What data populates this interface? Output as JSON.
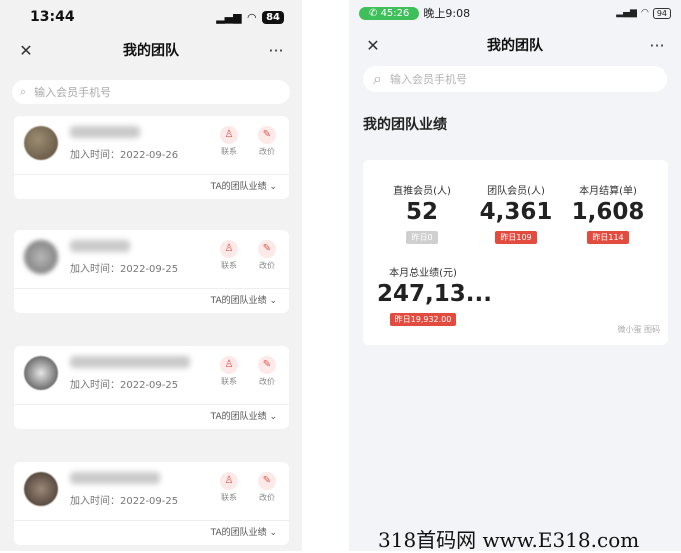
{
  "left": {
    "status": {
      "time": "13:44",
      "battery": "84"
    },
    "nav": {
      "close": "✕",
      "title": "我的团队",
      "more": "···"
    },
    "search": {
      "placeholder": "输入会员手机号"
    },
    "members": [
      {
        "joined": "加入时间：2022-09-26",
        "contact": "联系",
        "edit": "改价",
        "perf": "TA的团队业绩 ⌄"
      },
      {
        "joined": "加入时间：2022-09-25",
        "contact": "联系",
        "edit": "改价",
        "perf": "TA的团队业绩 ⌄"
      },
      {
        "joined": "加入时间：2022-09-25",
        "contact": "联系",
        "edit": "改价",
        "perf": "TA的团队业绩 ⌄"
      },
      {
        "joined": "加入时间：2022-09-25",
        "contact": "联系",
        "edit": "改价",
        "perf": "TA的团队业绩 ⌄"
      }
    ]
  },
  "right": {
    "status": {
      "call": "45:26",
      "time": "晚上9:08",
      "battery": "94"
    },
    "nav": {
      "close": "✕",
      "title": "我的团队",
      "more": "···"
    },
    "search": {
      "placeholder": "输入会员手机号"
    },
    "perf_title": "我的团队业绩",
    "stats": [
      {
        "label": "直推会员(人)",
        "value": "52",
        "badge": "昨日0"
      },
      {
        "label": "团队会员(人)",
        "value": "4,361",
        "badge": "昨日109"
      },
      {
        "label": "本月结算(单)",
        "value": "1,608",
        "badge": "昨日114"
      },
      {
        "label": "本月总业绩(元)",
        "value": "247,13...",
        "badge": "昨日19,932.00"
      }
    ],
    "watermark": "微小蛋 图码"
  },
  "site_watermark": "318首码网 www.E318.com",
  "colors": {
    "accent": "#e44b3f",
    "green": "#3fbf5a"
  }
}
